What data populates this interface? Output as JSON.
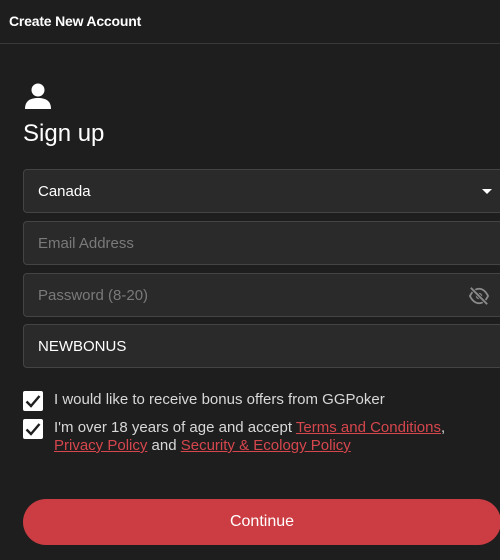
{
  "window": {
    "title": "Create New Account"
  },
  "form": {
    "heading": "Sign up",
    "country": {
      "value": "Canada"
    },
    "email": {
      "value": "",
      "placeholder": "Email Address"
    },
    "password": {
      "value": "",
      "placeholder": "Password (8-20)"
    },
    "promo_code": {
      "value": "NEWBONUS"
    },
    "bonus_checkbox": {
      "checked": true,
      "label": "I would like to receive bonus offers from GGPoker"
    },
    "terms_checkbox": {
      "checked": true,
      "prefix": "I'm over 18 years of age and accept ",
      "terms_link": "Terms and Conditions",
      "comma": ",",
      "privacy_link": "Privacy Policy",
      "and_text": " and ",
      "security_link": "Security & Ecology Policy"
    },
    "continue_label": "Continue"
  },
  "icons": {
    "user": "user-icon",
    "dropdown": "caret-down-icon",
    "password_visibility": "eye-slash-icon",
    "check": "checkmark-icon"
  },
  "colors": {
    "background": "#1e1e1e",
    "field_background": "#2a2a2a",
    "accent": "#cc3d43",
    "link": "#d6464d"
  }
}
